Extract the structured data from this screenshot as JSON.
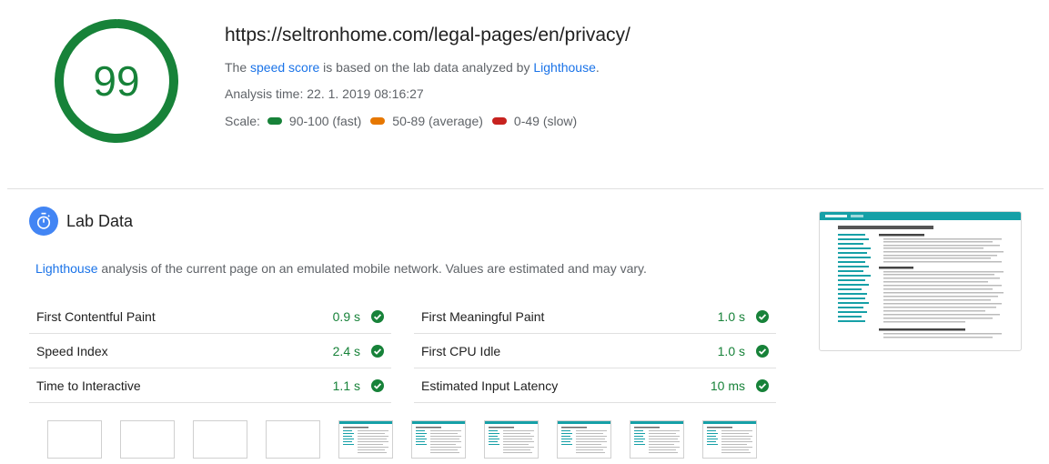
{
  "score": {
    "value": "99",
    "fraction": 0.99,
    "color": "#178239"
  },
  "header": {
    "url": "https://seltronhome.com/legal-pages/en/privacy/",
    "desc_prefix": "The ",
    "desc_link1": "speed score",
    "desc_middle": " is based on the lab data analyzed by ",
    "desc_link2": "Lighthouse",
    "desc_suffix": ".",
    "analysis_time": "Analysis time: 22. 1. 2019 08:16:27"
  },
  "scale": {
    "label": "Scale:",
    "items": [
      {
        "label": "90-100 (fast)",
        "color": "#178239"
      },
      {
        "label": "50-89 (average)",
        "color": "#e67700"
      },
      {
        "label": "0-49 (slow)",
        "color": "#c7221f"
      }
    ]
  },
  "lab": {
    "title": "Lab Data",
    "icon": "stopwatch-icon",
    "desc_link": "Lighthouse",
    "desc_rest": " analysis of the current page on an emulated mobile network. Values are estimated and may vary.",
    "metrics_left": [
      {
        "label": "First Contentful Paint",
        "value": "0.9 s"
      },
      {
        "label": "Speed Index",
        "value": "2.4 s"
      },
      {
        "label": "Time to Interactive",
        "value": "1.1 s"
      }
    ],
    "metrics_right": [
      {
        "label": "First Meaningful Paint",
        "value": "1.0 s"
      },
      {
        "label": "First CPU Idle",
        "value": "1.0 s"
      },
      {
        "label": "Estimated Input Latency",
        "value": "10 ms"
      }
    ],
    "pass_icon": "check-circle-icon",
    "pass_color": "#178239"
  },
  "filmstrip": {
    "frames": [
      "blank",
      "blank",
      "blank",
      "blank",
      "page",
      "page",
      "page",
      "page",
      "page",
      "page"
    ]
  }
}
